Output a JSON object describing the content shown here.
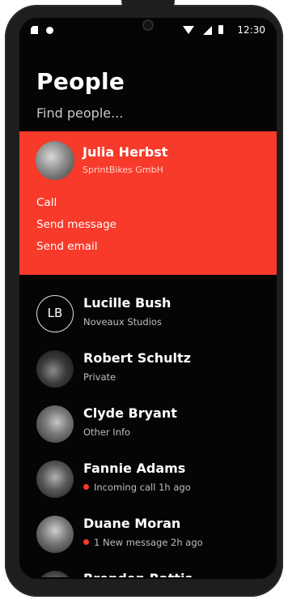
{
  "status_bar": {
    "time": "12:30",
    "icons": [
      "sd-card-icon",
      "notification-dot-icon",
      "wifi-icon",
      "signal-icon",
      "battery-icon"
    ]
  },
  "page": {
    "title": "People",
    "search_placeholder": "Find people..."
  },
  "expanded_contact": {
    "name": "Julia Herbst",
    "subtitle": "SprintBikes GmbH",
    "actions": [
      "Call",
      "Send message",
      "Send email"
    ],
    "accent_color": "#f73a2a"
  },
  "contacts": [
    {
      "name": "Lucille Bush",
      "subtitle": "Noveaux Studios",
      "initials": "LB"
    },
    {
      "name": "Robert Schultz",
      "subtitle": "Private"
    },
    {
      "name": "Clyde Bryant",
      "subtitle": "Other Info"
    },
    {
      "name": "Fannie Adams",
      "subtitle": "Incoming call 1h ago",
      "has_indicator": true
    },
    {
      "name": "Duane Moran",
      "subtitle": "1 New message 2h ago",
      "has_indicator": true
    },
    {
      "name": "Brenden Rattis"
    }
  ]
}
